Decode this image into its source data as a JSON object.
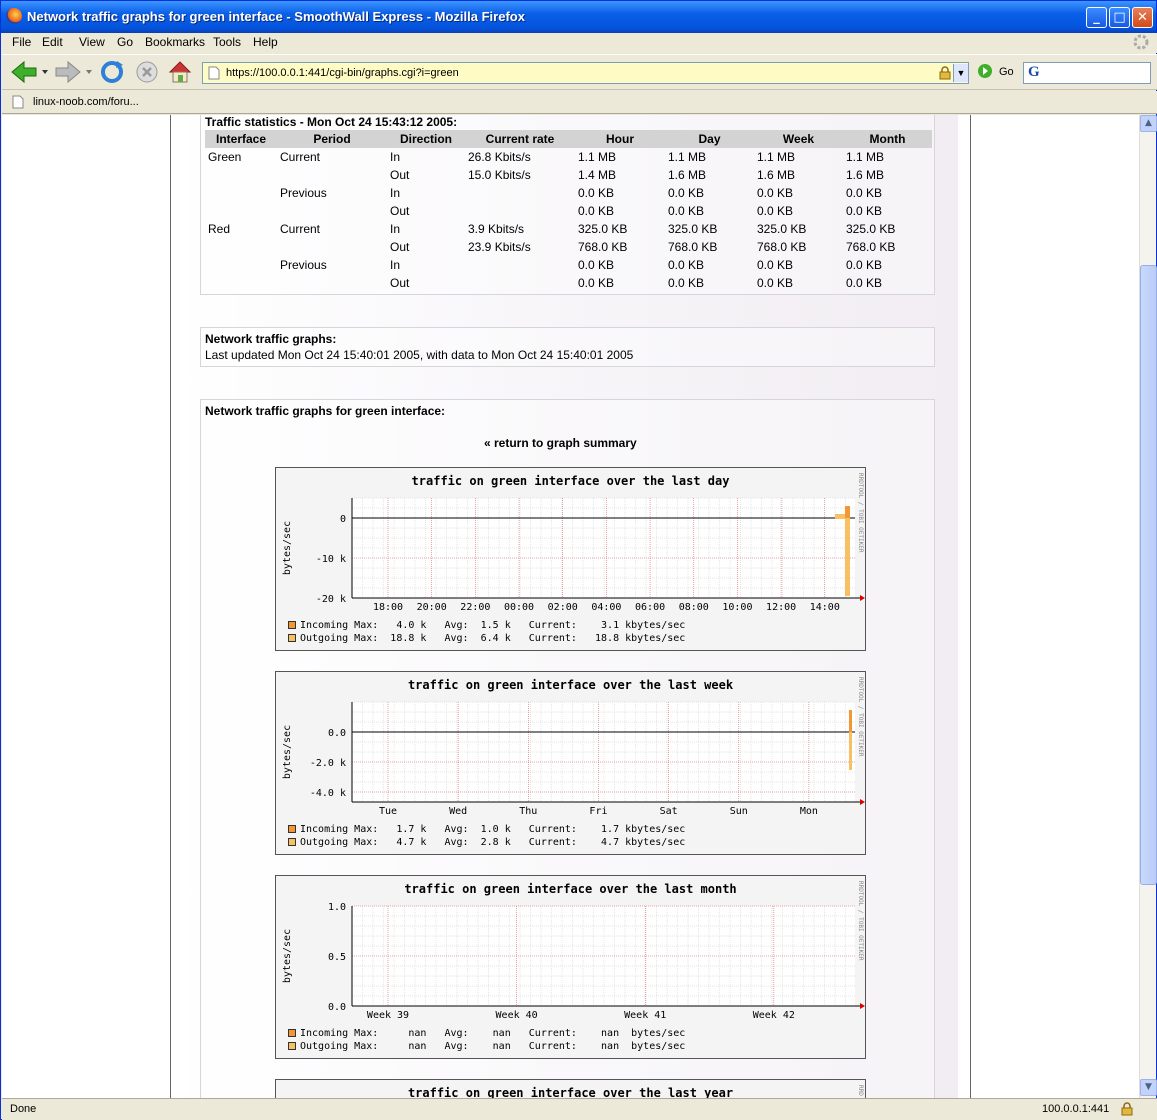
{
  "window": {
    "title": "Network traffic graphs for green interface - SmoothWall Express - Mozilla Firefox"
  },
  "menu": [
    "File",
    "Edit",
    "View",
    "Go",
    "Bookmarks",
    "Tools",
    "Help"
  ],
  "toolbar": {
    "url": "https://100.0.0.1:441/cgi-bin/graphs.cgi?i=green",
    "go_label": "Go"
  },
  "bookmarks": {
    "item": "linux-noob.com/foru..."
  },
  "stats": {
    "title": "Traffic statistics - Mon Oct 24 15:43:12 2005:",
    "headers": [
      "Interface",
      "Period",
      "Direction",
      "Current rate",
      "Hour",
      "Day",
      "Week",
      "Month"
    ],
    "rows": [
      [
        "Green",
        "Current",
        "In",
        "26.8 Kbits/s",
        "1.1 MB",
        "1.1 MB",
        "1.1 MB",
        "1.1 MB"
      ],
      [
        "",
        "",
        "Out",
        "15.0 Kbits/s",
        "1.4 MB",
        "1.6 MB",
        "1.6 MB",
        "1.6 MB"
      ],
      [
        "",
        "Previous",
        "In",
        "",
        "0.0 KB",
        "0.0 KB",
        "0.0 KB",
        "0.0 KB"
      ],
      [
        "",
        "",
        "Out",
        "",
        "0.0 KB",
        "0.0 KB",
        "0.0 KB",
        "0.0 KB"
      ],
      [
        "Red",
        "Current",
        "In",
        "3.9 Kbits/s",
        "325.0 KB",
        "325.0 KB",
        "325.0 KB",
        "325.0 KB"
      ],
      [
        "",
        "",
        "Out",
        "23.9 Kbits/s",
        "768.0 KB",
        "768.0 KB",
        "768.0 KB",
        "768.0 KB"
      ],
      [
        "",
        "Previous",
        "In",
        "",
        "0.0 KB",
        "0.0 KB",
        "0.0 KB",
        "0.0 KB"
      ],
      [
        "",
        "",
        "Out",
        "",
        "0.0 KB",
        "0.0 KB",
        "0.0 KB",
        "0.0 KB"
      ]
    ]
  },
  "updated": {
    "title": "Network traffic graphs:",
    "text": "Last updated Mon Oct 24 15:40:01 2005, with data to Mon Oct 24 15:40:01 2005"
  },
  "graphs_section": {
    "title": "Network traffic graphs for green interface:",
    "return_link": "« return to graph summary"
  },
  "chart_data": [
    {
      "type": "area",
      "title": "traffic on green interface over the last day",
      "ylabel": "bytes/sec",
      "side_label": "RRDTOOL / TOBI OETIKER",
      "yticks": [
        "0",
        "-10 k",
        "-20 k"
      ],
      "ylim": [
        -20000,
        2000
      ],
      "xticks": [
        "18:00",
        "20:00",
        "22:00",
        "00:00",
        "02:00",
        "04:00",
        "06:00",
        "08:00",
        "10:00",
        "12:00",
        "14:00"
      ],
      "series": [
        {
          "name": "Incoming",
          "color": "#f29636"
        },
        {
          "name": "Outgoing",
          "color": "#f7c163"
        }
      ],
      "legend": [
        {
          "name": "Incoming",
          "max": "4.0 k",
          "avg": "1.5 k",
          "current": "3.1 kbytes/sec"
        },
        {
          "name": "Outgoing",
          "max": "18.8 k",
          "avg": "6.4 k",
          "current": "18.8 kbytes/sec"
        }
      ]
    },
    {
      "type": "area",
      "title": "traffic on green interface over the last week",
      "ylabel": "bytes/sec",
      "side_label": "RRDTOOL / TOBI OETIKER",
      "yticks": [
        "0.0",
        "-2.0 k",
        "-4.0 k"
      ],
      "ylim": [
        -4900,
        1800
      ],
      "xticks": [
        "Tue",
        "Wed",
        "Thu",
        "Fri",
        "Sat",
        "Sun",
        "Mon"
      ],
      "series": [
        {
          "name": "Incoming",
          "color": "#f29636"
        },
        {
          "name": "Outgoing",
          "color": "#f7c163"
        }
      ],
      "legend": [
        {
          "name": "Incoming",
          "max": "1.7 k",
          "avg": "1.0 k",
          "current": "1.7 kbytes/sec"
        },
        {
          "name": "Outgoing",
          "max": "4.7 k",
          "avg": "2.8 k",
          "current": "4.7 kbytes/sec"
        }
      ]
    },
    {
      "type": "area",
      "title": "traffic on green interface over the last month",
      "ylabel": "bytes/sec",
      "side_label": "RRDTOOL / TOBI OETIKER",
      "yticks": [
        "1.0",
        "0.5",
        "0.0"
      ],
      "ylim": [
        0,
        1
      ],
      "xticks": [
        "Week 39",
        "Week 40",
        "Week 41",
        "Week 42"
      ],
      "series": [
        {
          "name": "Incoming",
          "color": "#f29636"
        },
        {
          "name": "Outgoing",
          "color": "#f7c163"
        }
      ],
      "legend": [
        {
          "name": "Incoming",
          "max": "nan",
          "avg": "nan",
          "current": "nan  bytes/sec"
        },
        {
          "name": "Outgoing",
          "max": "nan",
          "avg": "nan",
          "current": "nan  bytes/sec"
        }
      ]
    },
    {
      "type": "area",
      "title": "traffic on green interface over the last year",
      "side_label": "RRD"
    }
  ],
  "status": {
    "left": "Done",
    "right": "100.0.0.1:441"
  }
}
